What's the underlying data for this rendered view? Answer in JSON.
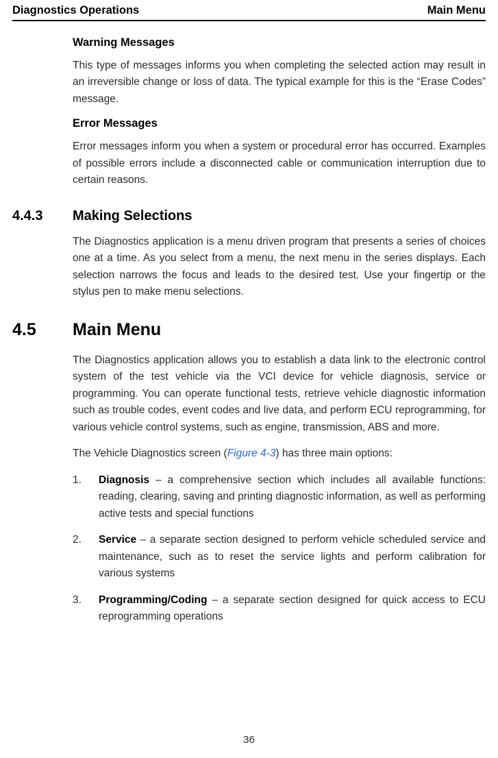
{
  "header": {
    "left": "Diagnostics Operations",
    "right": "Main Menu"
  },
  "sections": {
    "warning": {
      "title": "Warning Messages",
      "body": "This type of messages informs you when completing the selected action may result in an irreversible change or loss of data. The typical example for this is the “Erase Codes” message."
    },
    "error": {
      "title": "Error Messages",
      "body": "Error messages inform you when a system or procedural error has occurred. Examples of possible errors include a disconnected cable or communication interruption due to certain reasons."
    },
    "making_selections": {
      "num": "4.4.3",
      "title": "Making Selections",
      "body": "The Diagnostics application is a menu driven program that presents a series of choices one at a time. As you select from a menu, the next menu in the series displays. Each selection narrows the focus and leads to the desired test. Use your fingertip or the stylus pen to make menu selections."
    },
    "main_menu": {
      "num": "4.5",
      "title": "Main Menu",
      "intro": "The Diagnostics application allows you to establish a data link to the electronic control system of the test vehicle via the VCI device for vehicle diagnosis, service or programming. You can operate functional tests, retrieve vehicle diagnostic information such as trouble codes, event codes and live data, and perform ECU reprogramming, for various vehicle control systems, such as engine, transmission, ABS and more.",
      "xref_pre": "The Vehicle Diagnostics screen (",
      "xref": "Figure 4-3",
      "xref_post": ") has three main options:",
      "items": [
        {
          "num": "1.",
          "bold": "Diagnosis",
          "rest": " – a comprehensive section which includes all available functions: reading, clearing, saving and printing diagnostic information, as well as performing active tests and special functions"
        },
        {
          "num": "2.",
          "bold": "Service",
          "rest": " – a separate section designed to perform vehicle scheduled service and maintenance, such as to reset the service lights and perform calibration for various systems"
        },
        {
          "num": "3.",
          "bold": "Programming/Coding",
          "rest": " – a separate section designed for quick access to ECU reprogramming operations"
        }
      ]
    }
  },
  "page_number": "36"
}
